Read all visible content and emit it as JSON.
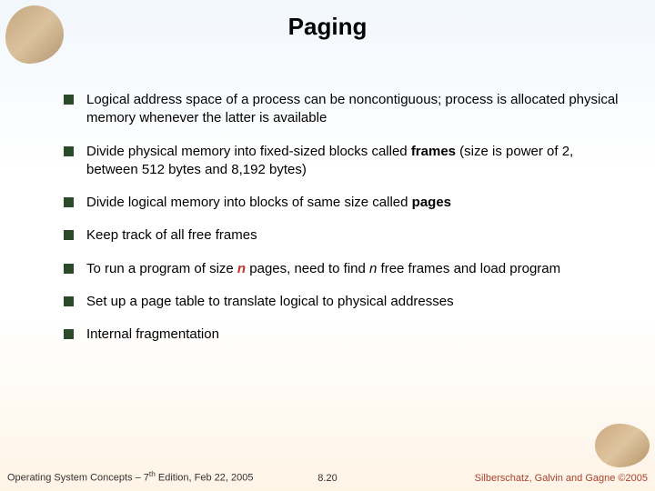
{
  "title": "Paging",
  "bullets": [
    {
      "html": "Logical address space of a process can be noncontiguous; process is allocated physical memory whenever the latter is available"
    },
    {
      "html": "Divide physical memory into fixed-sized blocks called <span class='bold'>frames</span> (size is power of 2, between 512 bytes and 8,192 bytes)"
    },
    {
      "html": "Divide logical memory into blocks of same size called <span class='bold'>pages</span>"
    },
    {
      "html": "Keep track of all free frames"
    },
    {
      "html": "To run a program of size <span class='nvar'>n</span> pages, need to find <span class='nvar2'>n</span> free frames and load program"
    },
    {
      "html": "Set up a page table to translate logical to physical addresses"
    },
    {
      "html": "Internal fragmentation"
    }
  ],
  "footer": {
    "left": "Operating System Concepts – 7<sup>th</sup> Edition, Feb 22, 2005",
    "center": "8.20",
    "right": "Silberschatz, Galvin and Gagne ©2005"
  }
}
